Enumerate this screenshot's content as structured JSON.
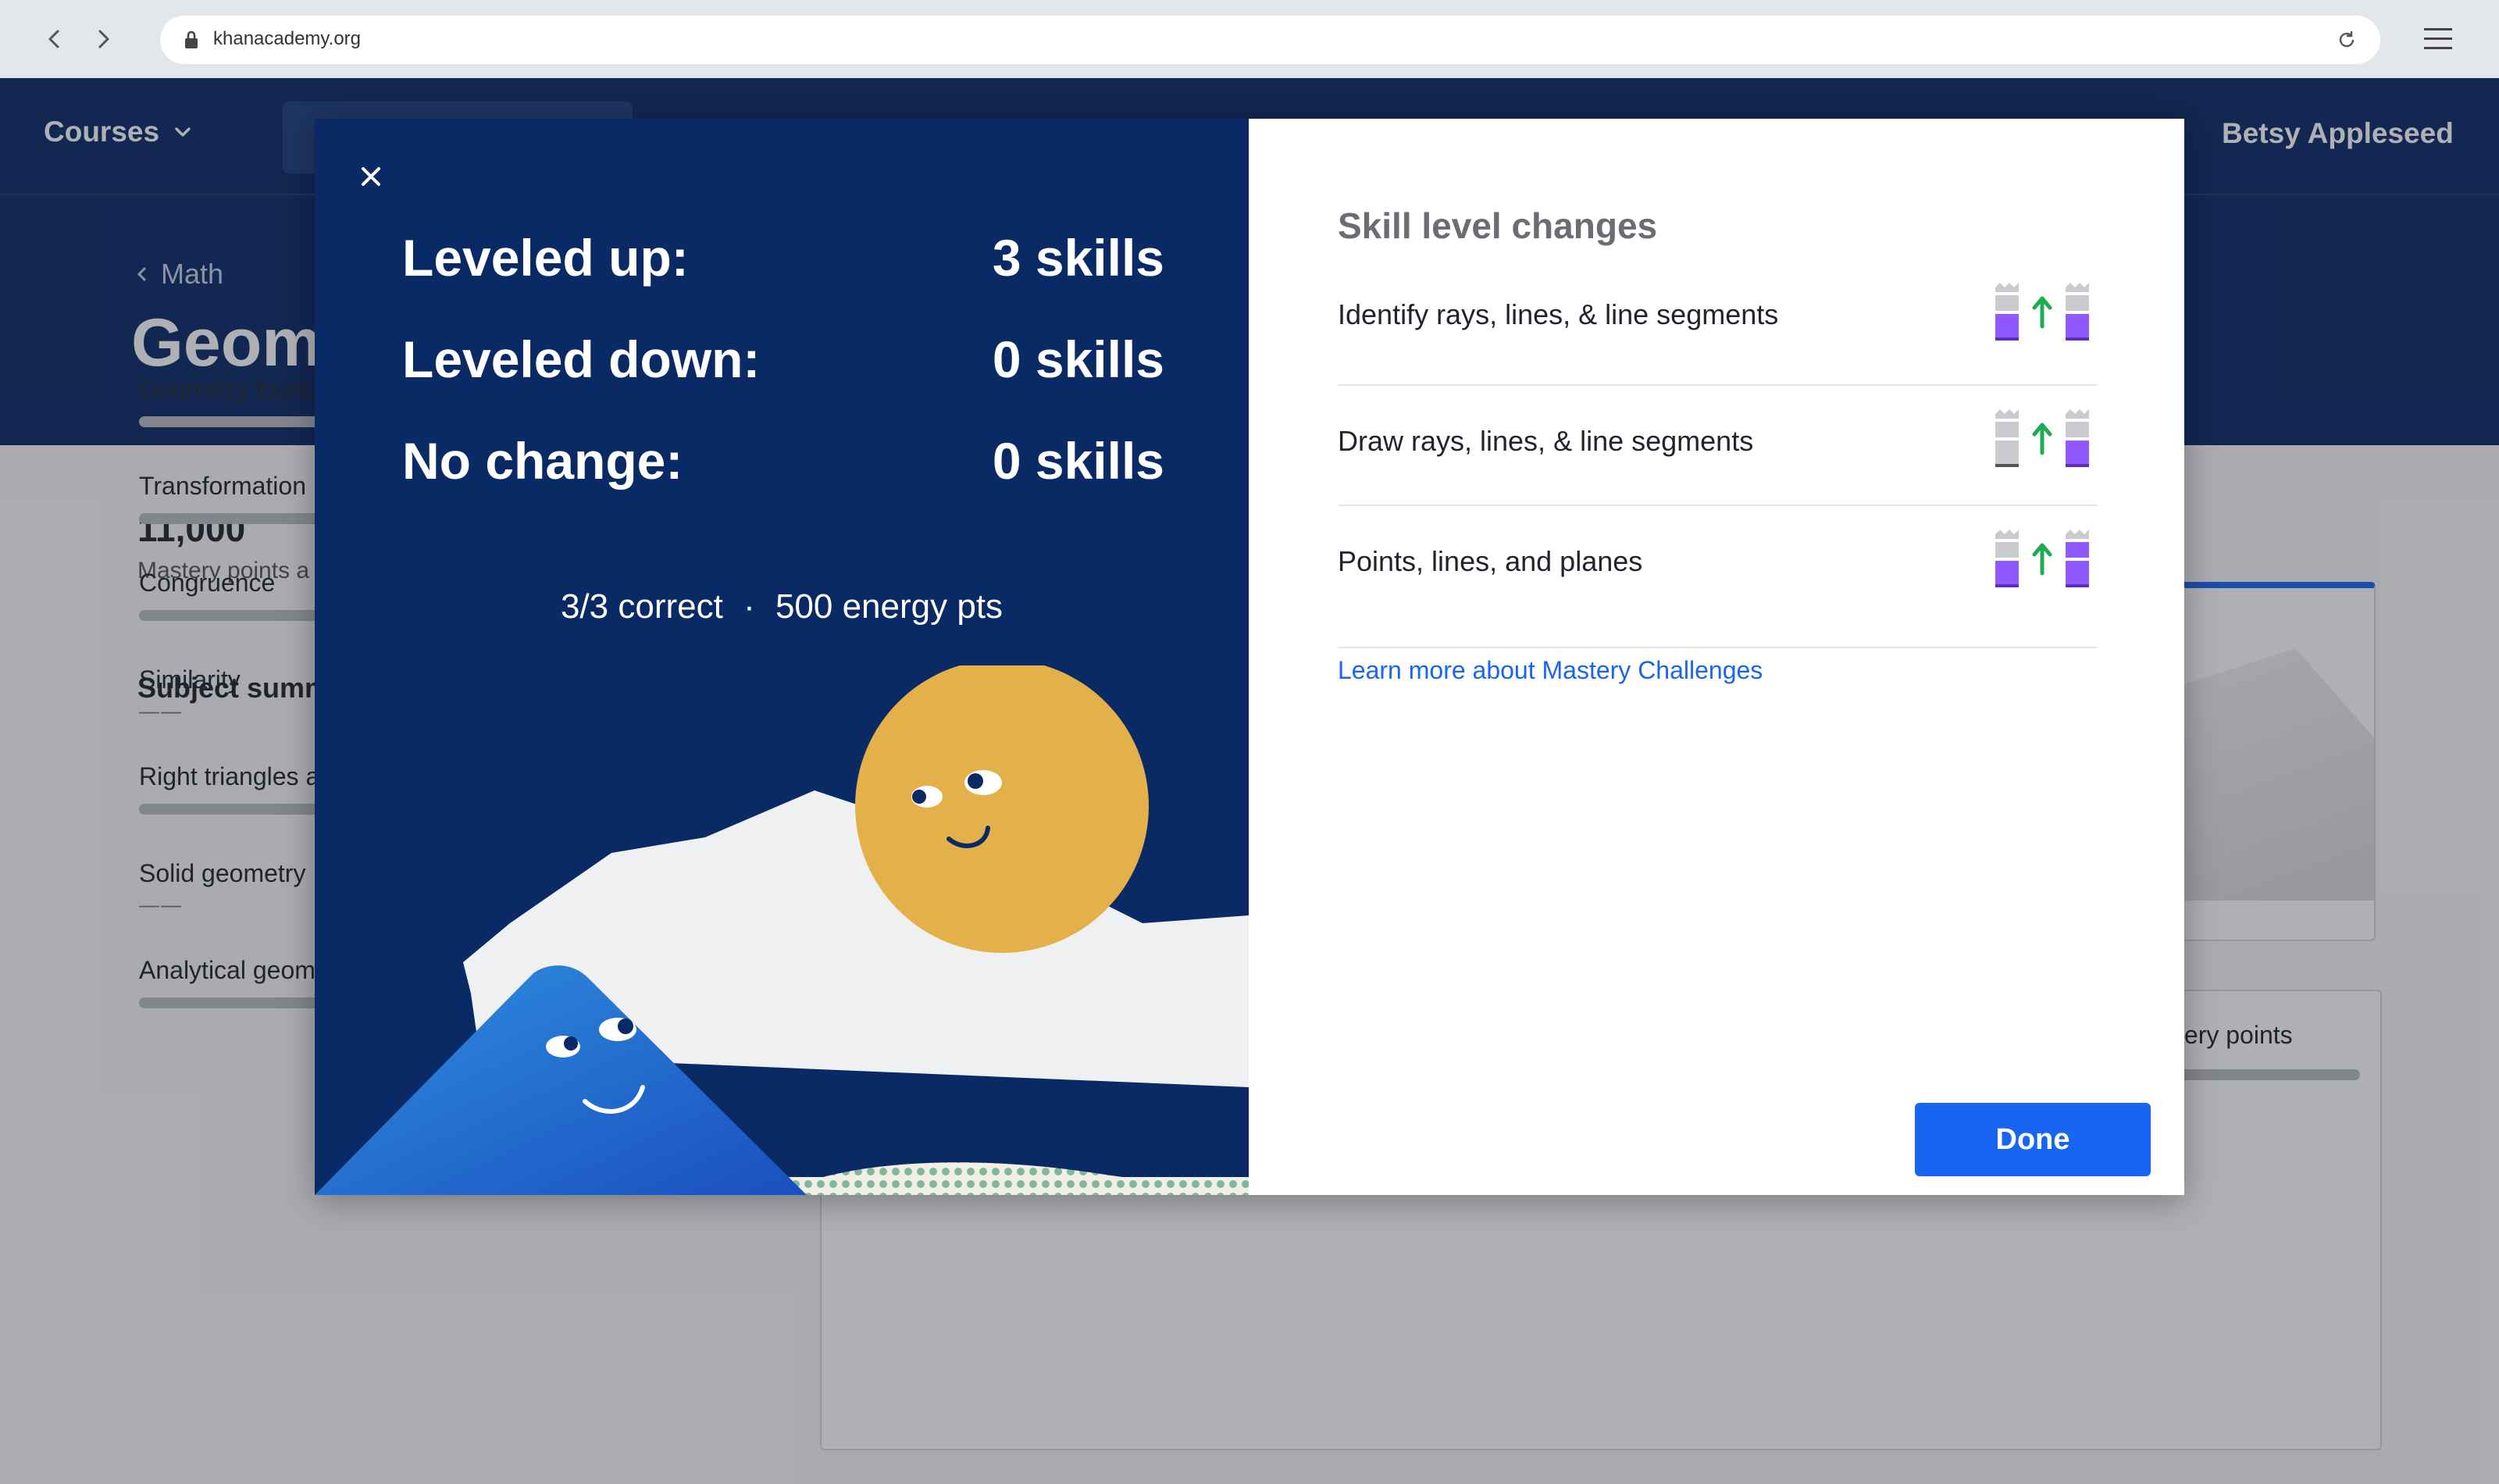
{
  "browser": {
    "url": "khanacademy.org"
  },
  "topnav": {
    "courses_label": "Courses",
    "username": "Betsy Appleseed"
  },
  "hero": {
    "breadcrumb": "Math",
    "title": "Geom"
  },
  "sidebar": {
    "mastery_total": "11,000",
    "mastery_label": "Mastery points a",
    "subject_heading": "Subject summ",
    "units": [
      {
        "name": "Geometry found",
        "status": "bar"
      },
      {
        "name": "Transformation",
        "status": "bar"
      },
      {
        "name": "Congruence",
        "status": "bar"
      },
      {
        "name": "Similarity",
        "status": "dash"
      },
      {
        "name": "Right triangles a",
        "status": "bar"
      },
      {
        "name": "Solid geometry",
        "status": "dash"
      },
      {
        "name": "Analytical geometry",
        "status": "bar"
      }
    ],
    "unit_dash": "——"
  },
  "right_panel": {
    "mastery_points_label": "stery points"
  },
  "modal": {
    "summary": [
      {
        "label": "Leveled up:",
        "value": "3 skills"
      },
      {
        "label": "Leveled down:",
        "value": "0 skills"
      },
      {
        "label": "No change:",
        "value": "0 skills"
      }
    ],
    "correct": "3/3 correct",
    "separator": "·",
    "energy": "500 energy pts",
    "skill_heading": "Skill level changes",
    "skills": [
      {
        "name": "Identify rays, lines, & line segments",
        "from_level": 0.5,
        "to_level": 0.5
      },
      {
        "name": "Draw rays, lines, & line segments",
        "from_level": 0,
        "to_level": 0.5
      },
      {
        "name": "Points, lines, and planes",
        "from_level": 0.5,
        "to_level": 1
      }
    ],
    "learn_more": "Learn more about Mastery Challenges",
    "done_label": "Done"
  },
  "colors": {
    "navy": "#0a2a66",
    "primary_blue": "#1865f2",
    "mastery_purple": "#9059ff",
    "level_up_green": "#1fab54",
    "sun": "#e3b04a"
  }
}
